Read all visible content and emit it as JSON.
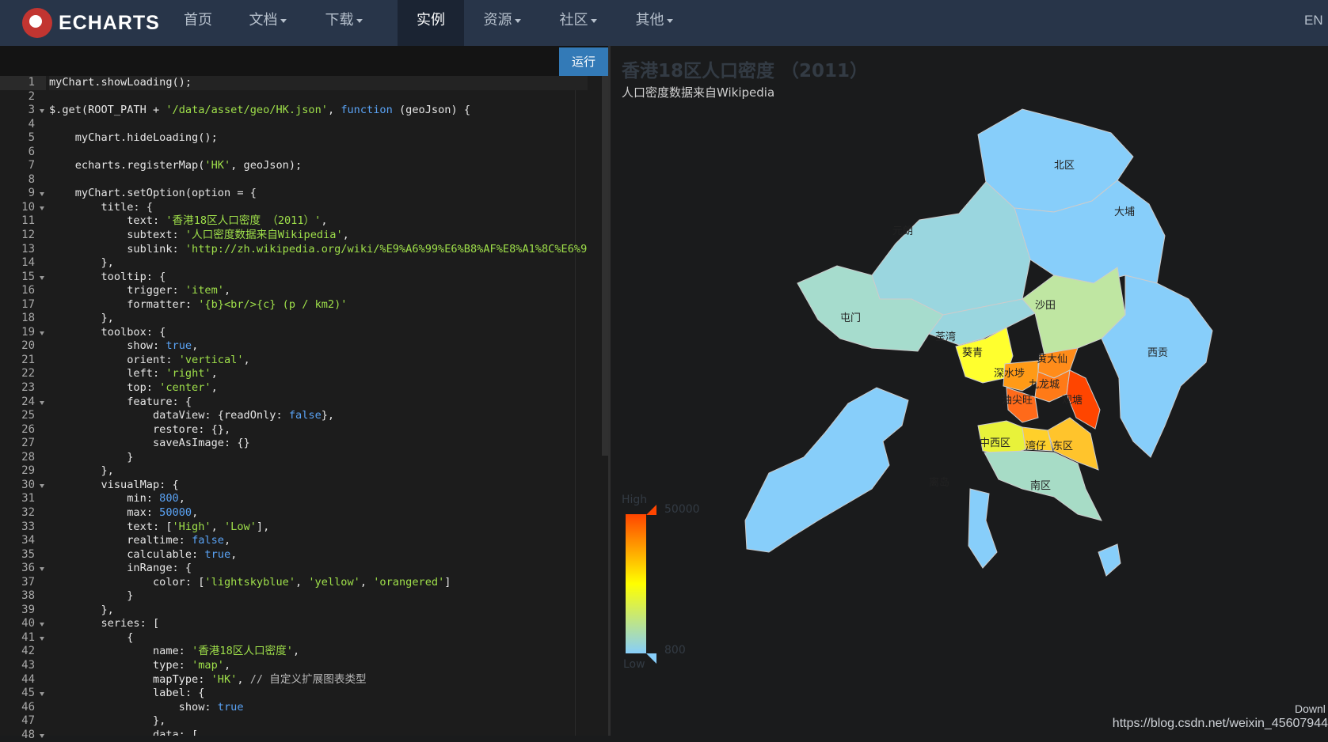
{
  "nav": {
    "logo": "ECHARTS",
    "items": [
      {
        "label": "首页",
        "dropdown": false
      },
      {
        "label": "文档",
        "dropdown": true
      },
      {
        "label": "下载",
        "dropdown": true
      },
      {
        "label": "实例",
        "dropdown": false,
        "active": true
      },
      {
        "label": "资源",
        "dropdown": true
      },
      {
        "label": "社区",
        "dropdown": true
      },
      {
        "label": "其他",
        "dropdown": true
      }
    ],
    "lang": "EN"
  },
  "editor": {
    "run_label": "运行",
    "lines": [
      "myChart.showLoading();",
      "",
      "$.get(ROOT_PATH + '/data/asset/geo/HK.json', function (geoJson) {",
      "",
      "    myChart.hideLoading();",
      "",
      "    echarts.registerMap('HK', geoJson);",
      "",
      "    myChart.setOption(option = {",
      "        title: {",
      "            text: '香港18区人口密度 （2011）',",
      "            subtext: '人口密度数据来自Wikipedia',",
      "            sublink: 'http://zh.wikipedia.org/wiki/%E9%A6%99%E6%B8%AF%E8%A1%8C%E6%9",
      "        },",
      "        tooltip: {",
      "            trigger: 'item',",
      "            formatter: '{b}<br/>{c} (p / km2)'",
      "        },",
      "        toolbox: {",
      "            show: true,",
      "            orient: 'vertical',",
      "            left: 'right',",
      "            top: 'center',",
      "            feature: {",
      "                dataView: {readOnly: false},",
      "                restore: {},",
      "                saveAsImage: {}",
      "            }",
      "        },",
      "        visualMap: {",
      "            min: 800,",
      "            max: 50000,",
      "            text: ['High', 'Low'],",
      "            realtime: false,",
      "            calculable: true,",
      "            inRange: {",
      "                color: ['lightskyblue', 'yellow', 'orangered']",
      "            }",
      "        },",
      "        series: [",
      "            {",
      "                name: '香港18区人口密度',",
      "                type: 'map',",
      "                mapType: 'HK', // 自定义扩展图表类型",
      "                label: {",
      "                    show: true",
      "                },",
      "                data: ["
    ],
    "fold_lines": [
      3,
      9,
      10,
      15,
      19,
      24,
      30,
      36,
      40,
      41,
      45,
      48
    ]
  },
  "chart": {
    "title": "香港18区人口密度 （2011）",
    "subtitle": "人口密度数据来自Wikipedia",
    "visual_map": {
      "high_text": "High",
      "low_text": "Low",
      "max": "50000",
      "min": "800",
      "colors": [
        "#87cefa",
        "#ffff00",
        "#ff4500"
      ]
    },
    "regions": [
      {
        "label": "北区"
      },
      {
        "label": "大埔"
      },
      {
        "label": "元朗"
      },
      {
        "label": "沙田"
      },
      {
        "label": "屯门"
      },
      {
        "label": "荃湾"
      },
      {
        "label": "葵青"
      },
      {
        "label": "黄大仙"
      },
      {
        "label": "深水埗"
      },
      {
        "label": "九龙城"
      },
      {
        "label": "油尖旺"
      },
      {
        "label": "观塘"
      },
      {
        "label": "西贡"
      },
      {
        "label": "中西区"
      },
      {
        "label": "湾仔"
      },
      {
        "label": "东区"
      },
      {
        "label": "南区"
      },
      {
        "label": "离岛"
      }
    ]
  },
  "watermark": "https://blog.csdn.net/weixin_45607944",
  "corner_tab": "Downl"
}
